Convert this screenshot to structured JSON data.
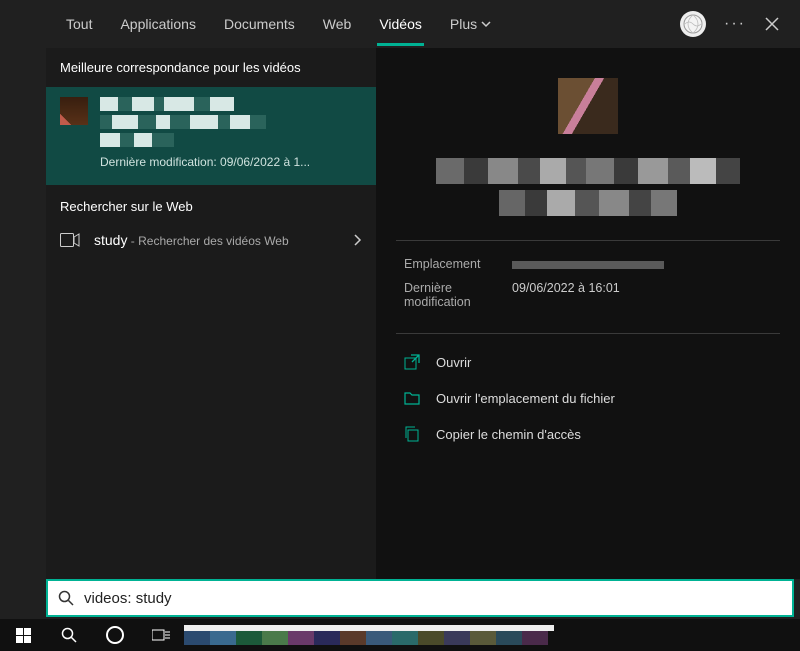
{
  "tabs": {
    "all": "Tout",
    "apps": "Applications",
    "docs": "Documents",
    "web": "Web",
    "videos": "Vidéos",
    "more": "Plus"
  },
  "left": {
    "best_match_header": "Meilleure correspondance pour les vidéos",
    "best_match_sub": "Dernière modification: 09/06/2022 à 1...",
    "web_header": "Rechercher sur le Web",
    "web_item_prefix": "study",
    "web_item_suffix": " - Rechercher des vidéos Web"
  },
  "right": {
    "meta": {
      "location_label": "Emplacement",
      "modified_label": "Dernière modification",
      "modified_value": "09/06/2022 à 16:01"
    },
    "actions": {
      "open": "Ouvrir",
      "open_location": "Ouvrir l'emplacement du fichier",
      "copy_path": "Copier le chemin d'accès"
    }
  },
  "search": {
    "value": "videos: study"
  }
}
